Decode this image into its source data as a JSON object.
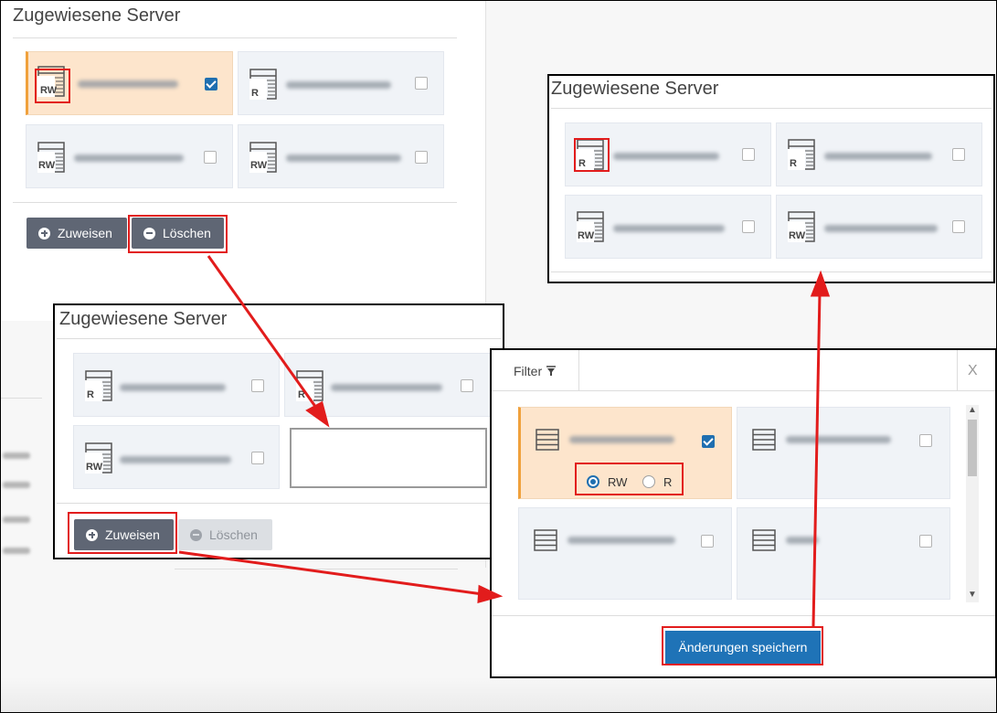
{
  "panel_title": "Zugewiesene Server",
  "buttons": {
    "assign": "Zuweisen",
    "delete": "Löschen"
  },
  "server_badges": {
    "rw": "RW",
    "r": "R"
  },
  "dialog": {
    "filter_label": "Filter",
    "close_label": "X",
    "radio_rw": "RW",
    "radio_r": "R",
    "save_label": "Änderungen speichern"
  },
  "colors": {
    "annotation": "#e21c1c",
    "selected_card": "#fde5cc",
    "selected_card_accent": "#f0a13c",
    "button_dark": "#5f6674",
    "save_button": "#1f73b7",
    "checkbox_checked": "#1f6fb0"
  },
  "panels": {
    "top_left": {
      "servers": [
        {
          "access": "RW",
          "selected": true,
          "checked": true
        },
        {
          "access": "R",
          "selected": false,
          "checked": false
        },
        {
          "access": "RW",
          "selected": false,
          "checked": false
        },
        {
          "access": "RW",
          "selected": false,
          "checked": false
        }
      ]
    },
    "top_right": {
      "servers": [
        {
          "access": "R",
          "checked": false
        },
        {
          "access": "R",
          "checked": false
        },
        {
          "access": "RW",
          "checked": false
        },
        {
          "access": "RW",
          "checked": false
        }
      ]
    },
    "middle": {
      "servers": [
        {
          "access": "R",
          "checked": false
        },
        {
          "access": "R",
          "checked": false
        },
        {
          "access": "RW",
          "checked": false
        }
      ]
    },
    "dialog_list": {
      "servers": [
        {
          "selected": true,
          "checked": true,
          "radio_selected": "RW"
        },
        {
          "selected": false,
          "checked": false
        },
        {
          "selected": false,
          "checked": false
        },
        {
          "selected": false,
          "checked": false
        }
      ]
    }
  },
  "icons": [
    "server-rw-icon",
    "server-r-icon",
    "server-icon",
    "filter-icon",
    "plus-circle-icon",
    "minus-circle-icon",
    "chevron-up-icon",
    "chevron-down-icon",
    "arrow-icon"
  ]
}
